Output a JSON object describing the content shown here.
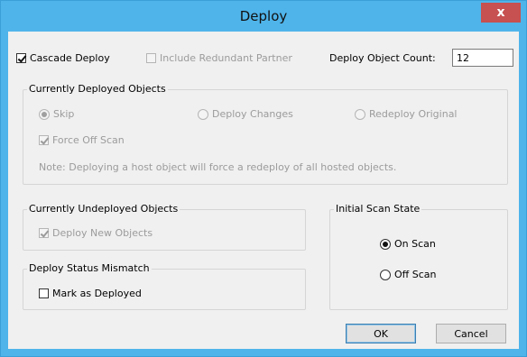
{
  "window": {
    "title": "Deploy",
    "close_glyph": "x"
  },
  "top": {
    "cascade_deploy": {
      "label": "Cascade Deploy",
      "checked": true
    },
    "include_redundant": {
      "label": "Include Redundant Partner",
      "checked": false,
      "enabled": false
    },
    "deploy_object_count_label": "Deploy Object Count:",
    "deploy_object_count_value": "12"
  },
  "currently_deployed": {
    "title": "Currently Deployed Objects",
    "options": [
      "Skip",
      "Deploy Changes",
      "Redeploy Original"
    ],
    "selected": "Skip",
    "force_off_scan": {
      "label": "Force Off Scan",
      "checked": true
    },
    "note": "Note: Deploying a host object will force a redeploy of all hosted objects."
  },
  "currently_undeployed": {
    "title": "Currently Undeployed Objects",
    "deploy_new": {
      "label": "Deploy New Objects",
      "checked": true
    }
  },
  "status_mismatch": {
    "title": "Deploy Status Mismatch",
    "mark_as_deployed": {
      "label": "Mark as Deployed",
      "checked": false
    }
  },
  "initial_scan": {
    "title": "Initial Scan State",
    "options": [
      "On Scan",
      "Off Scan"
    ],
    "selected": "On Scan"
  },
  "buttons": {
    "ok": "OK",
    "cancel": "Cancel"
  }
}
